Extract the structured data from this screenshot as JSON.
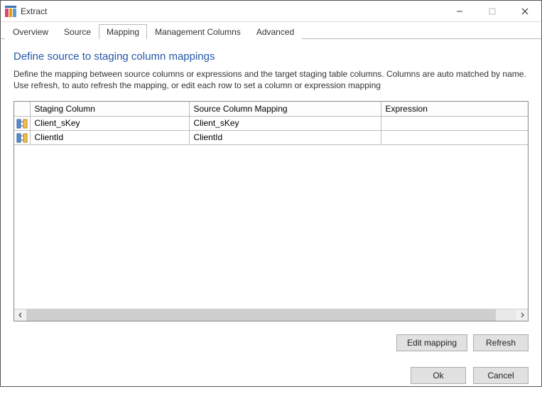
{
  "window": {
    "title": "Extract"
  },
  "tabs": {
    "overview": "Overview",
    "source": "Source",
    "mapping": "Mapping",
    "mgmt": "Management Columns",
    "advanced": "Advanced"
  },
  "section": {
    "title": "Define source to staging column mappings",
    "desc_line1": "Define the mapping between source columns or expressions and the target staging table columns. Columns are auto matched by name.",
    "desc_line2": "Use refresh, to auto refresh the mapping, or edit each row to set a column or expression mapping"
  },
  "grid": {
    "headers": {
      "staging": "Staging Column",
      "source": "Source Column Mapping",
      "expression": "Expression"
    },
    "rows": [
      {
        "staging": "Client_sKey",
        "source": "Client_sKey",
        "expression": ""
      },
      {
        "staging": "ClientId",
        "source": "ClientId",
        "expression": ""
      }
    ]
  },
  "buttons": {
    "edit_mapping": "Edit mapping",
    "refresh": "Refresh",
    "ok": "Ok",
    "cancel": "Cancel"
  }
}
